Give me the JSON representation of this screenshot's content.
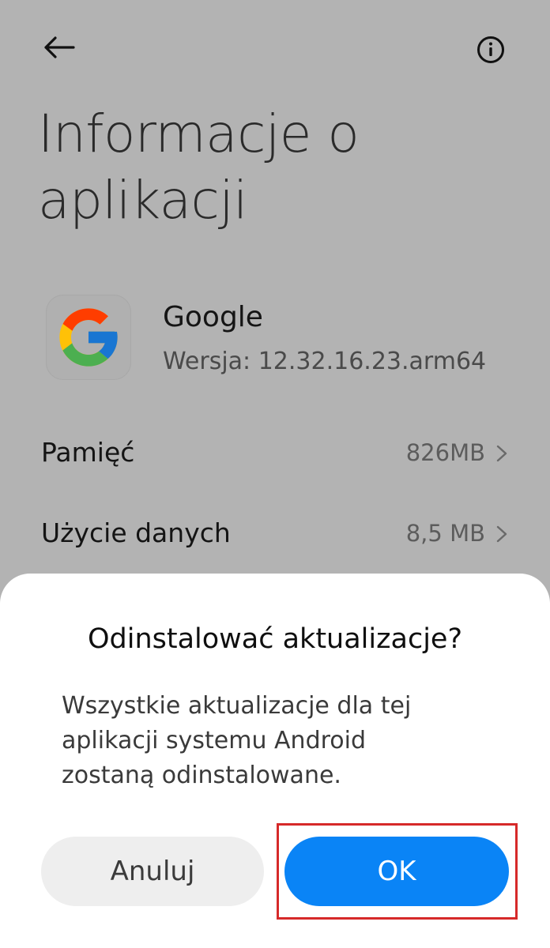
{
  "header": {
    "back_icon": "arrow-left-icon",
    "info_icon": "info-circle-icon",
    "title_line1": "Informacje o",
    "title_line2": "aplikacji"
  },
  "app": {
    "icon": "google-g-logo",
    "name": "Google",
    "version": "Wersja: 12.32.16.23.arm64"
  },
  "rows": [
    {
      "label": "Pamięć",
      "value": "826MB",
      "icon": "chevron-right-icon"
    },
    {
      "label": "Użycie danych",
      "value": "8,5 MB",
      "icon": "chevron-right-icon"
    }
  ],
  "dialog": {
    "title": "Odinstalować aktualizacje?",
    "body_line1": "Wszystkie aktualizacje dla tej",
    "body_line2": "aplikacji systemu Android",
    "body_line3": "zostaną odinstalowane.",
    "cancel_label": "Anuluj",
    "ok_label": "OK"
  },
  "colors": {
    "background_dimmed": "#b3b3b3",
    "dialog_background": "#ffffff",
    "ok_button": "#0a84f6",
    "cancel_button": "#eeeeee",
    "highlight_border": "#d62a2a"
  }
}
